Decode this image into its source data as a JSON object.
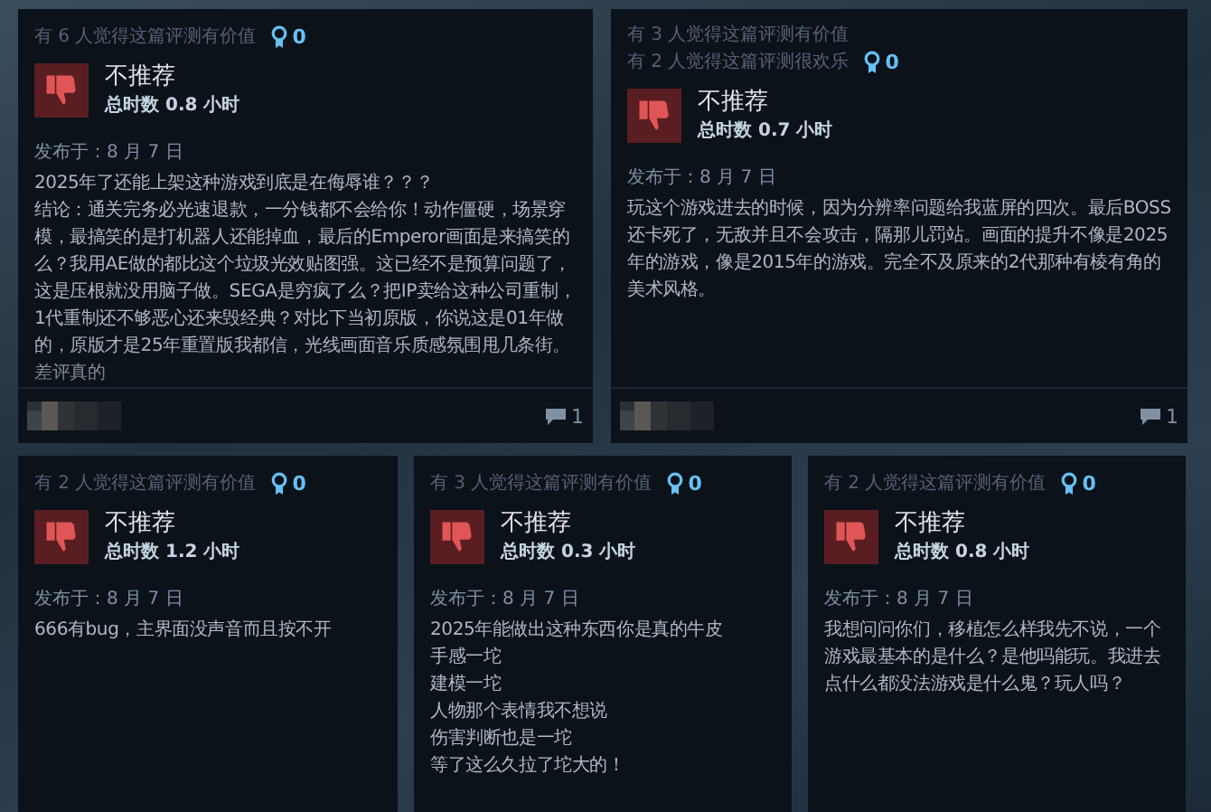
{
  "reviews": [
    {
      "helpful": [
        "有 6 人觉得这篇评测有价值"
      ],
      "awards": "0",
      "verdict": "不推荐",
      "recommended": false,
      "hours": "总时数 0.8 小时",
      "posted": "发布于：8 月 7 日",
      "body": [
        "2025年了还能上架这种游戏到底是在侮辱谁？？？",
        "结论：通关完务必光速退款，一分钱都不会给你！动作僵硬，场景穿模，最搞笑的是打机器人还能掉血，最后的Emperor画面是来搞笑的么？我用AE做的都比这个垃圾光效贴图强。这已经不是预算问题了，这是压根就没用脑子做。SEGA是穷疯了么？把IP卖给这种公司重制，1代重制还不够恶心还来毁经典？对比下当初原版，你说这是01年做的，原版才是25年重置版我都信，光线画面音乐质感氛围甩几条街。差评真的"
      ],
      "faded": true,
      "comments": "1"
    },
    {
      "helpful": [
        "有 3 人觉得这篇评测有价值",
        "有 2 人觉得这篇评测很欢乐"
      ],
      "awards": "0",
      "verdict": "不推荐",
      "recommended": false,
      "hours": "总时数 0.7 小时",
      "posted": "发布于：8 月 7 日",
      "body": [
        "玩这个游戏进去的时候，因为分辨率问题给我蓝屏的四次。最后BOSS还卡死了，无敌并且不会攻击，隔那儿罚站。画面的提升不像是2025年的游戏，像是2015年的游戏。完全不及原来的2代那种有棱有角的美术风格。"
      ],
      "comments": "1"
    },
    {
      "helpful": [
        "有 2 人觉得这篇评测有价值"
      ],
      "awards": "0",
      "verdict": "不推荐",
      "recommended": false,
      "hours": "总时数 1.2 小时",
      "posted": "发布于：8 月 7 日",
      "body": [
        "666有bug，主界面没声音而且按不开"
      ]
    },
    {
      "helpful": [
        "有 3 人觉得这篇评测有价值"
      ],
      "awards": "0",
      "verdict": "不推荐",
      "recommended": false,
      "hours": "总时数 0.3 小时",
      "posted": "发布于：8 月 7 日",
      "body": [
        "2025年能做出这种东西你是真的牛皮",
        "手感一坨",
        "建模一坨",
        "人物那个表情我不想说",
        "伤害判断也是一坨",
        "等了这么久拉了坨大的！"
      ]
    },
    {
      "helpful": [
        "有 2 人觉得这篇评测有价值"
      ],
      "awards": "0",
      "verdict": "不推荐",
      "recommended": false,
      "hours": "总时数 0.8 小时",
      "posted": "发布于：8 月 7 日",
      "body": [
        "我想问问你们，移植怎么样我先不说，一个游戏最基本的是什么？是他吗能玩。我进去点什么都没法游戏是什么鬼？玩人吗？"
      ]
    }
  ]
}
